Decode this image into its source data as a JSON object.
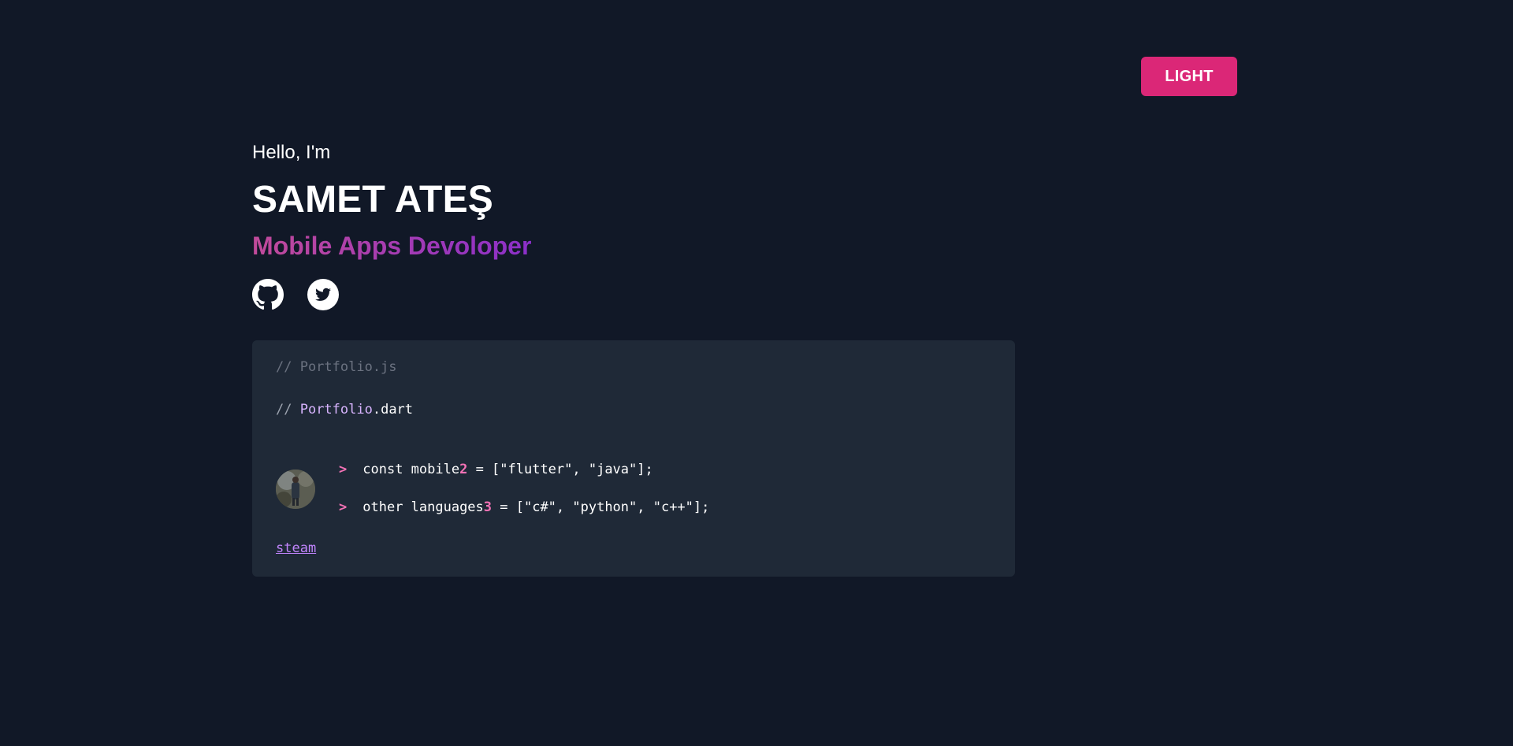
{
  "header": {
    "theme_toggle_label": "LIGHT"
  },
  "hero": {
    "greeting": "Hello, I'm",
    "name": "SAMET ATEŞ",
    "role": "Mobile Apps Devoloper",
    "socials": [
      {
        "icon": "github-icon"
      },
      {
        "icon": "twitter-icon"
      }
    ]
  },
  "code_card": {
    "comment_js": "// Portfolio.js",
    "comment_dart_slashes": "// ",
    "comment_dart_class": "Portfolio",
    "comment_dart_ext": ".dart",
    "prompt": ">",
    "line1": {
      "before": "const mobile",
      "number": "2",
      "after": " = [\"flutter\", \"java\"];"
    },
    "line2": {
      "before": "other languages",
      "number": "3",
      "after": " = [\"c#\", \"python\", \"c++\"];"
    },
    "link": "steam"
  },
  "colors": {
    "background": "#111827",
    "card": "#1f2937",
    "accent": "#db2777",
    "link": "#c084fc"
  }
}
